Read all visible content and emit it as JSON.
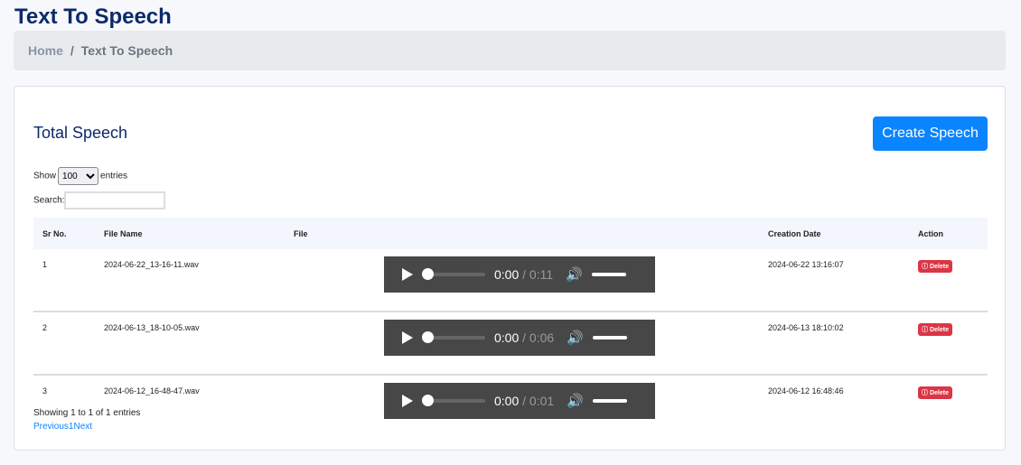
{
  "page_title": "Text To Speech",
  "breadcrumb": {
    "home": "Home",
    "separator": "/",
    "current": "Text To Speech"
  },
  "card": {
    "title": "Total Speech",
    "create_button": "Create Speech"
  },
  "length": {
    "show": "Show",
    "value": "100",
    "entries": "entries"
  },
  "search": {
    "label": "Search:",
    "value": ""
  },
  "table": {
    "headers": [
      "Sr No.",
      "File Name",
      "File",
      "Creation Date",
      "Action"
    ],
    "rows": [
      {
        "sr": "1",
        "file": "2024-06-22_13-16-11.wav",
        "current": "0:00",
        "duration": "/ 0:11",
        "date": "2024-06-22 13:16:07",
        "action": "Delete"
      },
      {
        "sr": "2",
        "file": "2024-06-13_18-10-05.wav",
        "current": "0:00",
        "duration": "/ 0:06",
        "date": "2024-06-13 18:10:02",
        "action": "Delete"
      },
      {
        "sr": "3",
        "file": "2024-06-12_16-48-47.wav",
        "current": "0:00",
        "duration": "/ 0:01",
        "date": "2024-06-12 16:48:46",
        "action": "Delete"
      }
    ]
  },
  "footer": {
    "info": "Showing 1 to 1 of 1 entries",
    "previous": "Previous",
    "page": "1",
    "next": "Next"
  },
  "colors": {
    "title": "#0b2a6b",
    "primary": "#0a84ff",
    "danger": "#dc3545"
  }
}
